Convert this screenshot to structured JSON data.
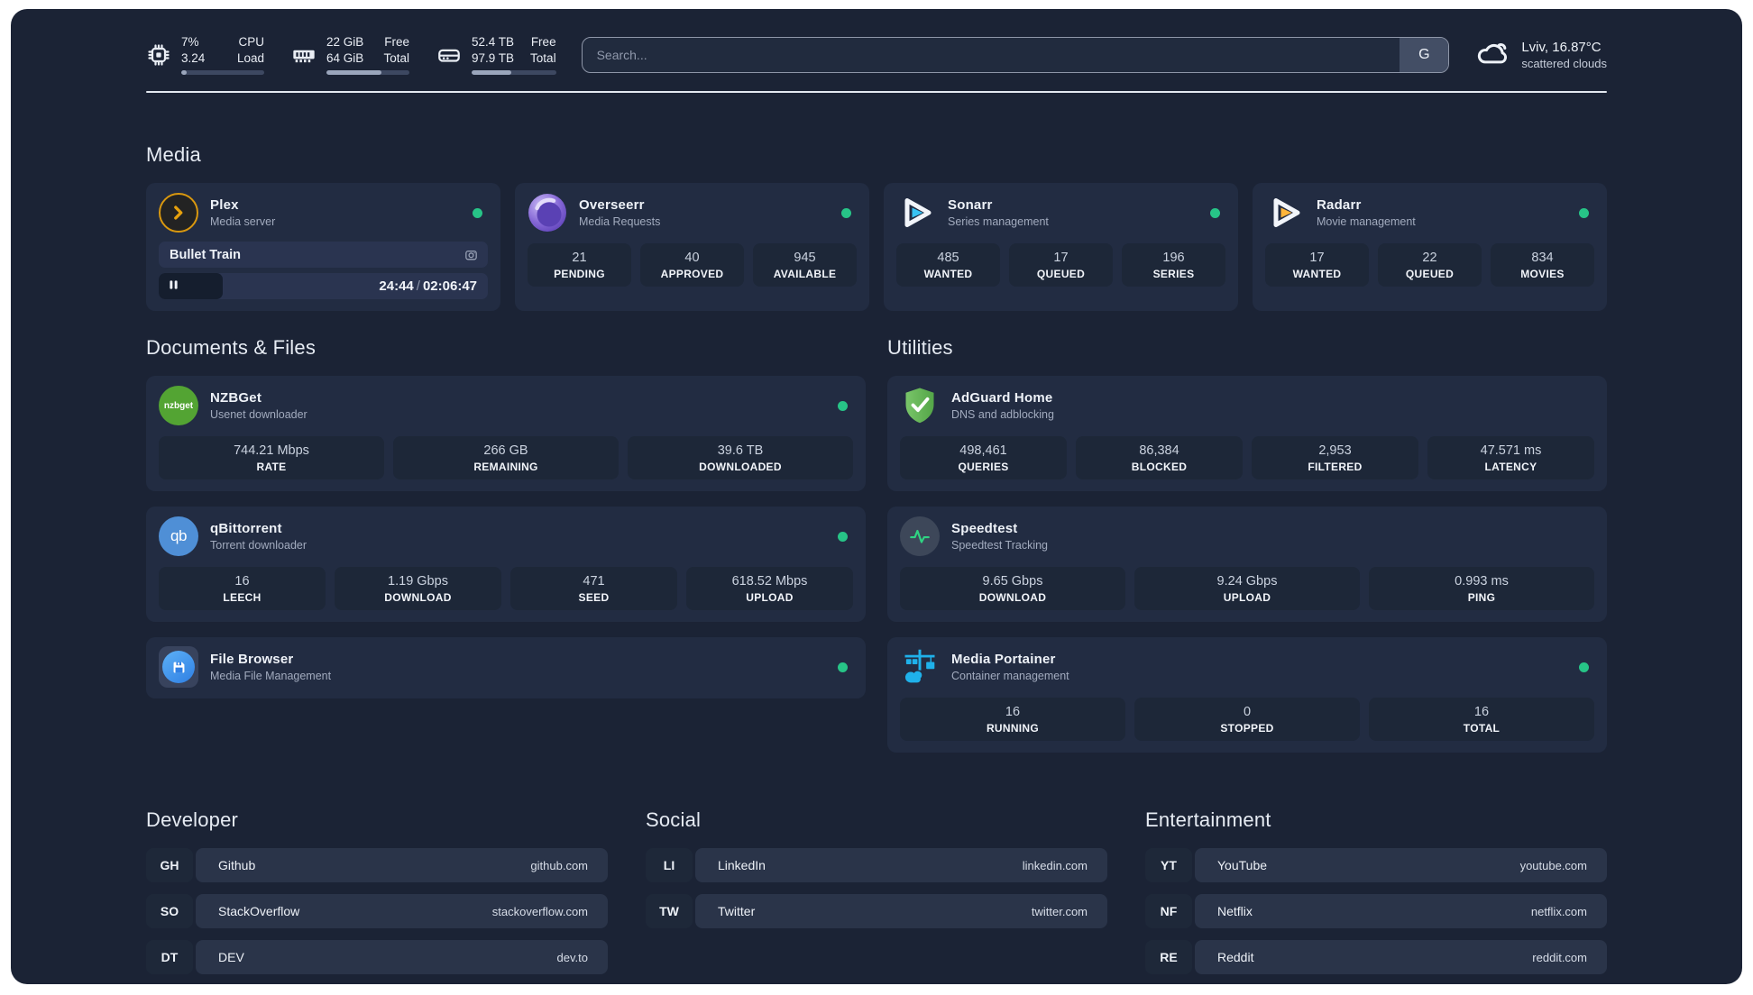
{
  "theme": {
    "page_bg": "#1b2335",
    "card_bg": "#222c42",
    "stat_bg": "#1d2738",
    "status_green": "#27c487"
  },
  "header": {
    "system_stats": [
      {
        "icon": "cpu-icon",
        "value_top": "7%",
        "value_bottom": "3.24",
        "label_top": "CPU",
        "label_bottom": "Load",
        "progress_pct": 7
      },
      {
        "icon": "ram-icon",
        "value_top": "22 GiB",
        "value_bottom": "64 GiB",
        "label_top": "Free",
        "label_bottom": "Total",
        "progress_pct": 66
      },
      {
        "icon": "disk-icon",
        "value_top": "52.4 TB",
        "value_bottom": "97.9 TB",
        "label_top": "Free",
        "label_bottom": "Total",
        "progress_pct": 47
      }
    ],
    "search": {
      "placeholder": "Search...",
      "button": "G"
    },
    "weather": {
      "icon": "cloud-icon",
      "location": "Lviv, 16.87°C",
      "condition": "scattered clouds"
    }
  },
  "app_sections": [
    {
      "id": "media",
      "title": "Media",
      "cards": [
        {
          "icon": "plex-icon",
          "name": "Plex",
          "subtitle": "Media server",
          "online": true,
          "now_playing": {
            "title": "Bullet Train",
            "elapsed": "24:44",
            "duration": "02:06:47",
            "progress_pct": 19.5
          }
        },
        {
          "icon": "overseerr-icon",
          "name": "Overseerr",
          "subtitle": "Media Requests",
          "online": true,
          "stats": [
            {
              "value": "21",
              "label": "PENDING"
            },
            {
              "value": "40",
              "label": "APPROVED"
            },
            {
              "value": "945",
              "label": "AVAILABLE"
            }
          ]
        },
        {
          "icon": "sonarr-icon",
          "name": "Sonarr",
          "subtitle": "Series management",
          "online": true,
          "stats": [
            {
              "value": "485",
              "label": "WANTED"
            },
            {
              "value": "17",
              "label": "QUEUED"
            },
            {
              "value": "196",
              "label": "SERIES"
            }
          ]
        },
        {
          "icon": "radarr-icon",
          "name": "Radarr",
          "subtitle": "Movie management",
          "online": true,
          "stats": [
            {
              "value": "17",
              "label": "WANTED"
            },
            {
              "value": "22",
              "label": "QUEUED"
            },
            {
              "value": "834",
              "label": "MOVIES"
            }
          ]
        }
      ]
    },
    {
      "id": "documents",
      "title": "Documents & Files",
      "cards": [
        {
          "icon": "nzbget-icon",
          "name": "NZBGet",
          "subtitle": "Usenet downloader",
          "online": true,
          "stats": [
            {
              "value": "744.21 Mbps",
              "label": "RATE"
            },
            {
              "value": "266 GB",
              "label": "REMAINING"
            },
            {
              "value": "39.6 TB",
              "label": "DOWNLOADED"
            }
          ]
        },
        {
          "icon": "qbittorrent-icon",
          "name": "qBittorrent",
          "subtitle": "Torrent downloader",
          "online": true,
          "stats": [
            {
              "value": "16",
              "label": "LEECH"
            },
            {
              "value": "1.19 Gbps",
              "label": "DOWNLOAD"
            },
            {
              "value": "471",
              "label": "SEED"
            },
            {
              "value": "618.52 Mbps",
              "label": "UPLOAD"
            }
          ]
        },
        {
          "icon": "filebrowser-icon",
          "name": "File Browser",
          "subtitle": "Media File Management",
          "online": true
        }
      ]
    },
    {
      "id": "utilities",
      "title": "Utilities",
      "cards": [
        {
          "icon": "adguard-icon",
          "name": "AdGuard Home",
          "subtitle": "DNS and adblocking",
          "online": false,
          "stats": [
            {
              "value": "498,461",
              "label": "QUERIES"
            },
            {
              "value": "86,384",
              "label": "BLOCKED"
            },
            {
              "value": "2,953",
              "label": "FILTERED"
            },
            {
              "value": "47.571 ms",
              "label": "LATENCY"
            }
          ]
        },
        {
          "icon": "speedtest-icon",
          "name": "Speedtest",
          "subtitle": "Speedtest Tracking",
          "online": false,
          "stats": [
            {
              "value": "9.65 Gbps",
              "label": "DOWNLOAD"
            },
            {
              "value": "9.24 Gbps",
              "label": "UPLOAD"
            },
            {
              "value": "0.993 ms",
              "label": "PING"
            }
          ]
        },
        {
          "icon": "portainer-icon",
          "name": "Media Portainer",
          "subtitle": "Container management",
          "online": true,
          "stats": [
            {
              "value": "16",
              "label": "RUNNING"
            },
            {
              "value": "0",
              "label": "STOPPED"
            },
            {
              "value": "16",
              "label": "TOTAL"
            }
          ]
        }
      ]
    }
  ],
  "bookmark_sections": [
    {
      "title": "Developer",
      "items": [
        {
          "abbr": "GH",
          "name": "Github",
          "url": "github.com"
        },
        {
          "abbr": "SO",
          "name": "StackOverflow",
          "url": "stackoverflow.com"
        },
        {
          "abbr": "DT",
          "name": "DEV",
          "url": "dev.to"
        }
      ]
    },
    {
      "title": "Social",
      "items": [
        {
          "abbr": "LI",
          "name": "LinkedIn",
          "url": "linkedin.com"
        },
        {
          "abbr": "TW",
          "name": "Twitter",
          "url": "twitter.com"
        }
      ]
    },
    {
      "title": "Entertainment",
      "items": [
        {
          "abbr": "YT",
          "name": "YouTube",
          "url": "youtube.com"
        },
        {
          "abbr": "NF",
          "name": "Netflix",
          "url": "netflix.com"
        },
        {
          "abbr": "RE",
          "name": "Reddit",
          "url": "reddit.com"
        }
      ]
    }
  ]
}
